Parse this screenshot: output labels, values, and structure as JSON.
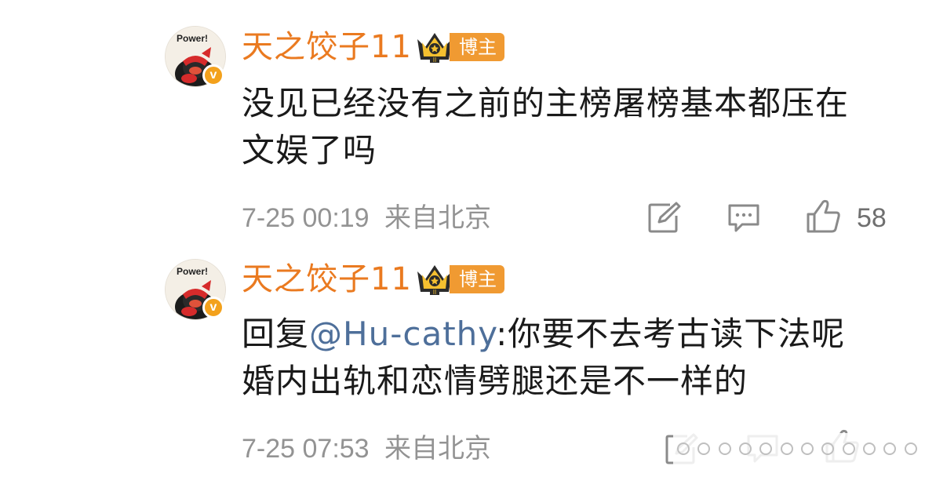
{
  "comments": [
    {
      "avatar_text": "Power!",
      "verified_mark": "v",
      "username": "天之饺子11",
      "tag": "博主",
      "text": "没见已经没有之前的主榜屠榜基本都压在文娱了吗",
      "time": "7-25 00:19",
      "location": "来自北京",
      "likes": "58"
    },
    {
      "avatar_text": "Power!",
      "verified_mark": "v",
      "username": "天之饺子11",
      "tag": "博主",
      "reply_prefix": "回复",
      "mention": "@Hu-cathy",
      "text": ":你要不去考古读下法呢婚内出轨和恋情劈腿还是不一样的",
      "time": "7-25 07:53",
      "location": "来自北京"
    }
  ],
  "colors": {
    "username": "#ea7a20",
    "tag_bg": "#f09a32",
    "mention": "#4e6f9a",
    "meta": "#939393",
    "verified": "#f3a11c"
  },
  "icons": [
    "repost-icon",
    "comment-icon",
    "like-icon",
    "crown-icon"
  ]
}
